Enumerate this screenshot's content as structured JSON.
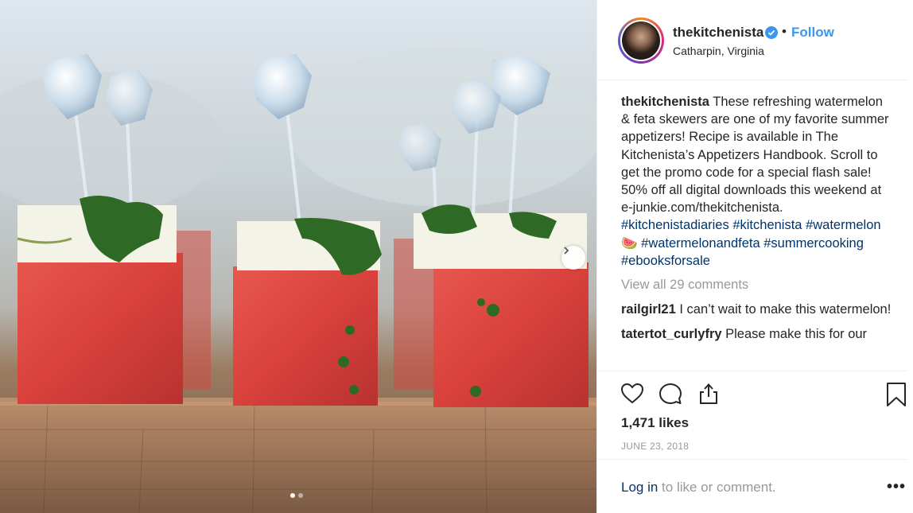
{
  "post": {
    "image_alt": "Watermelon and feta skewers on a wooden board",
    "carousel_dots": 2,
    "carousel_active": 0
  },
  "header": {
    "username": "thekitchenista",
    "bullet": "•",
    "follow_label": "Follow",
    "location": "Catharpin, Virginia"
  },
  "caption": {
    "username": "thekitchenista",
    "text": " These refreshing watermelon & feta skewers are one of my favorite summer appetizers! Recipe is available in The Kitchenista’s Appetizers Handbook. Scroll to get the promo code for a special flash sale! 50% off all digital downloads this weekend at e-junkie.com/thekitchenista. ",
    "hashtags": [
      "#kitchenistadiaries",
      "#kitchenista",
      "#watermelon🍉",
      "#watermelonandfeta",
      "#summercooking",
      "#ebooksforsale"
    ]
  },
  "comments": {
    "view_all": "View all 29 comments",
    "items": [
      {
        "user": "railgirl21",
        "text": " I can’t wait to make this watermelon!"
      },
      {
        "user": "tatertot_curlyfry",
        "text": " Please make this for our"
      }
    ]
  },
  "stats": {
    "likes": "1,471 likes",
    "date": "JUNE 23, 2018"
  },
  "footer": {
    "login_link": "Log in",
    "login_rest": " to like or comment.",
    "more": "•••"
  },
  "colors": {
    "link_blue": "#3897f0",
    "hashtag": "#003569",
    "muted": "#999999",
    "text": "#262626"
  }
}
